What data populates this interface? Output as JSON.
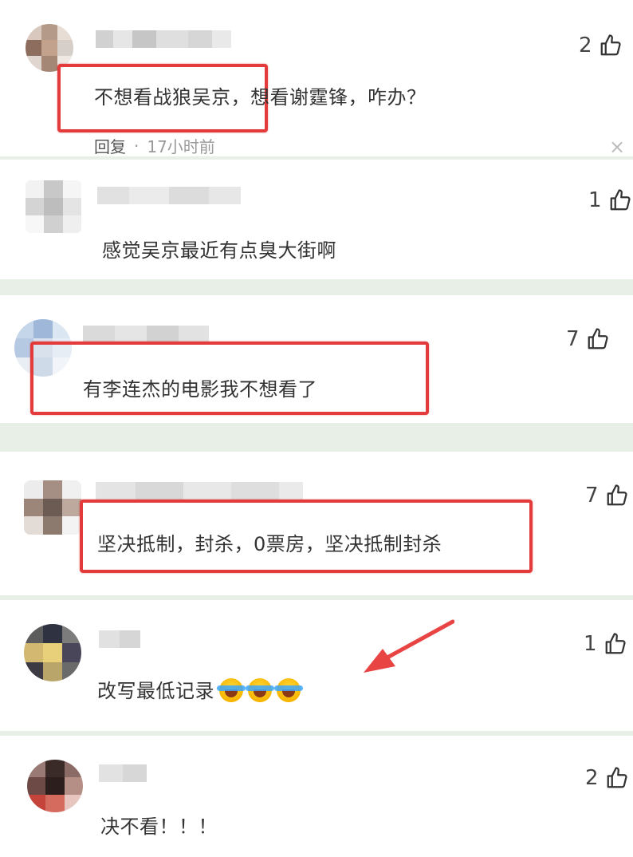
{
  "comments": [
    {
      "text": "不想看战狼吴京，想看谢霆锋，咋办？",
      "likes": "2",
      "reply_label": "回复",
      "time": "17小时前",
      "close": "×"
    },
    {
      "text": "感觉吴京最近有点臭大街啊",
      "likes": "1"
    },
    {
      "text": "有李连杰的电影我不想看了",
      "likes": "7"
    },
    {
      "text": "坚决抵制，封杀，0票房，坚决抵制封杀",
      "likes": "7"
    },
    {
      "text": "改写最低记录",
      "likes": "1",
      "emojis": [
        "crying-laughing-emoji",
        "crying-laughing-emoji",
        "crying-laughing-emoji"
      ]
    },
    {
      "text": "决不看！！！",
      "likes": "2"
    }
  ],
  "colors": {
    "highlight": "#e33b3b",
    "arrow": "#e84444",
    "separator": "#e8efe6"
  }
}
